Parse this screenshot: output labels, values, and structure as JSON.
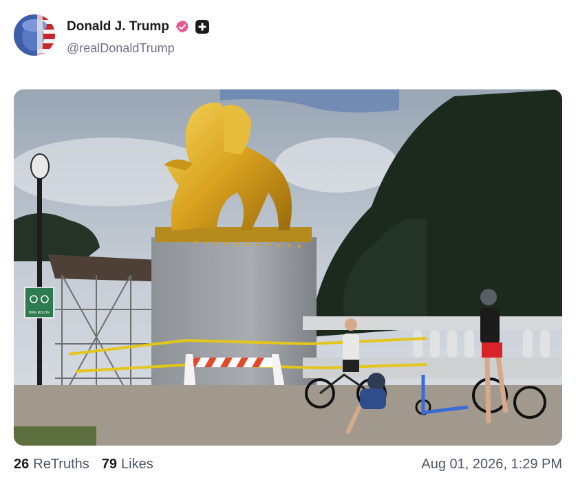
{
  "post": {
    "author": {
      "display_name": "Donald J. Trump",
      "handle": "@realDonaldTrump",
      "verified_icon": "verified-badge-icon",
      "verified_color": "#e8578f",
      "plus_icon": "plus-square-icon"
    },
    "image": {
      "sign_text_1": "BIKE ROUTE"
    },
    "stats": {
      "retruths_count": "26",
      "retruths_label": "ReTruths",
      "likes_count": "79",
      "likes_label": "Likes"
    },
    "timestamp": "Aug 01, 2026, 1:29 PM"
  }
}
